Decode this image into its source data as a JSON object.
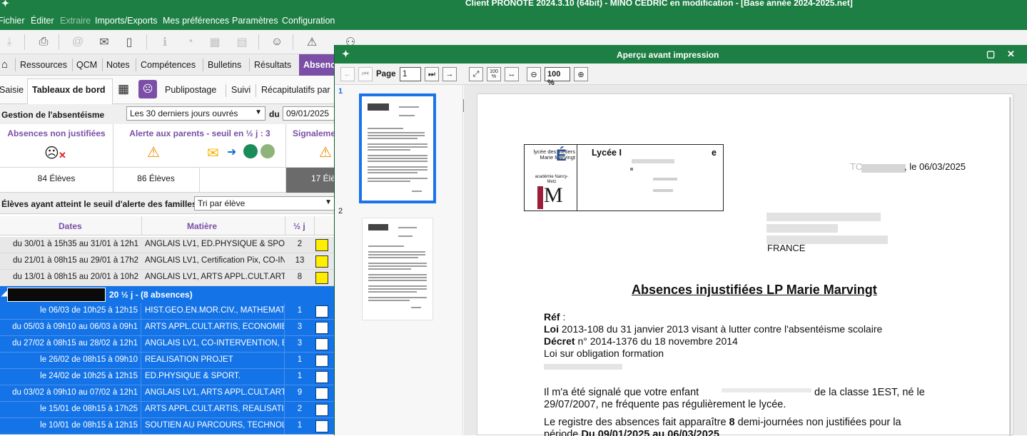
{
  "window_title": "Client PRONOTE 2024.3.10 (64bit) - MINO CEDRIC en modification - [Base année 2024-2025.net]",
  "menu": [
    "Fichier",
    "Éditer",
    "Extraire",
    "Imports/Exports",
    "Mes préférences",
    "Paramètres",
    "Configuration"
  ],
  "nav_tabs": [
    "Ressources",
    "QCM",
    "Notes",
    "Compétences",
    "Bulletins",
    "Résultats",
    "Absences"
  ],
  "sub_tabs": [
    "Saisie",
    "Tableaux de bord",
    "Publipostage",
    "Suivi",
    "Récapitulatifs par"
  ],
  "filter": {
    "label": "Gestion de l'absentéisme",
    "period": "Les 30 derniers jours ouvrés",
    "du_label": "du",
    "date_from": "09/01/2025"
  },
  "summary": {
    "col1_header": "Absences non justifiées",
    "col2_header": "Alerte aux parents - seuil en ½ j : 3",
    "col4_header": "Signaleme",
    "col1_count": "84 Élèves",
    "col2_count": "86 Élèves",
    "col4_count": "17 Élè"
  },
  "seuil": {
    "label": "Élèves ayant atteint le seuil d'alerte des familles",
    "sort": "Tri par élève"
  },
  "table": {
    "headers": [
      "Dates",
      "Matière",
      "½ j"
    ],
    "prev_rows": [
      {
        "dates": "du 30/01 à 15h35 au 31/01 à 12h1",
        "matiere": "ANGLAIS LV1, ED.PHYSIQUE & SPORT.,",
        "dj": "2"
      },
      {
        "dates": "du 21/01 à 08h15 au 29/01 à 17h2",
        "matiere": "ANGLAIS LV1, Certification Pix, CO-INTE",
        "dj": "13"
      },
      {
        "dates": "du 13/01 à 08h15 au 20/01 à 10h2",
        "matiere": "ANGLAIS LV1, ARTS APPL.CULT.ARTIS,",
        "dj": "8"
      }
    ],
    "group_label": "20 ½ j - (8 absences)",
    "rows": [
      {
        "dates": "le 06/03 de 10h25 à 12h15",
        "matiere": "HIST.GEO.EN.MOR.CIV., MATHEMATIQUE",
        "dj": "1"
      },
      {
        "dates": "du 05/03 à 09h10 au 06/03 à 09h1",
        "matiere": "ARTS APPL.CULT.ARTIS, ECONOMIE-GE",
        "dj": "3"
      },
      {
        "dates": "du 27/02 à 08h15 au 28/02 à 12h1",
        "matiere": "ANGLAIS LV1, CO-INTERVENTION, ED.F",
        "dj": "3"
      },
      {
        "dates": "le 26/02 de 08h15 à 09h10",
        "matiere": "REALISATION PROJET",
        "dj": "1"
      },
      {
        "dates": "le 24/02 de 10h25 à 12h15",
        "matiere": "ED.PHYSIQUE & SPORT.",
        "dj": "1"
      },
      {
        "dates": "du 03/02 à 09h10 au 07/02 à 12h1",
        "matiere": "ANGLAIS LV1, ARTS APPL.CULT.ARTIS,",
        "dj": "9"
      },
      {
        "dates": "le 15/01 de 08h15 à 17h25",
        "matiere": "ARTS APPL.CULT.ARTIS, REALISATION",
        "dj": "2"
      },
      {
        "dates": "le 10/01 de 08h15 à 12h15",
        "matiere": "SOUTIEN AU PARCOURS, TECHNOL.PRO",
        "dj": "1"
      }
    ]
  },
  "preview": {
    "title": "Aperçu avant impression",
    "page_label": "Page",
    "page_value": "1",
    "zoom": "100 %",
    "zoom_100_label": "100\n%",
    "thumb_numbers": [
      "1",
      "2"
    ],
    "doc": {
      "logo_text_vertical": "lycée des métiers Marie Marvingt",
      "logo_academie": "académie Nancy-Metz",
      "lycee_name_start": "Lycée I",
      "lycee_name_end": "e",
      "date_line": ", le 06/03/2025",
      "town_prefix": "TO",
      "country": "FRANCE",
      "heading": "Absences injustifiées LP Marie Marvingt",
      "ref": "Réf",
      "ref_colon": " :",
      "loi_label": "Loi",
      "loi_text": " 2013-108 du 31 janvier 2013 visant à lutter contre l'absentéisme scolaire",
      "decret_label": "Décret",
      "decret_text": " n° 2014-1376 du 18 novembre 2014",
      "obligation": "Loi sur obligation formation",
      "para1_a": "Il m'a été signalé que votre enfant",
      "para1_b": "de la classe 1EST, né le",
      "para1_c": "29/07/2007, ne fréquente pas régulièrement le lycée.",
      "para2_a": "Le registre des absences fait apparaître ",
      "para2_num": "8",
      "para2_b": " demi-journées non justifiées pour la",
      "para2_c": "période",
      "para2_d": " Du 09/01/2025 au 06/03/2025"
    }
  },
  "colors": {
    "green": "#1e7f45",
    "purple": "#7b4fa6",
    "blue_sel": "#1473e6",
    "yellow": "#ffee00"
  }
}
